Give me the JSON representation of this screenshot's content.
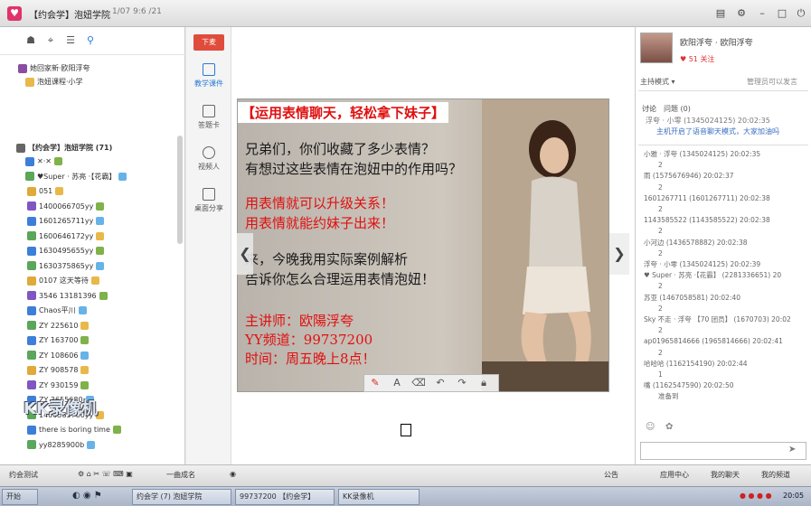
{
  "window": {
    "title": "【约会学】泡妞学院",
    "subtitle": "1/07  9:6  /21"
  },
  "left_panel": {
    "top_items": [
      {
        "label": "她回家新·欧阳浮夸"
      },
      {
        "label": "泡妞课程·小学"
      }
    ],
    "channel": "【约会学】泡妞学院 (71)",
    "members": [
      {
        "name": "✕·✕"
      },
      {
        "name": "♥Super · 苏亮 ·【花霸】"
      },
      {
        "name": "051"
      },
      {
        "name": "1400066705yy"
      },
      {
        "name": "1601265711yy"
      },
      {
        "name": "1600646172yy"
      },
      {
        "name": "1630495655yy"
      },
      {
        "name": "1630375865yy"
      },
      {
        "name": "0107 这天等待"
      },
      {
        "name": "3546 13181396"
      },
      {
        "name": "Chaos平川"
      },
      {
        "name": "ZY 225610"
      },
      {
        "name": "ZY 163700"
      },
      {
        "name": "ZY 108606"
      },
      {
        "name": "ZY 908578"
      },
      {
        "name": "ZY 930159"
      },
      {
        "name": "ZY 3655680"
      },
      {
        "name": "1400585700yy"
      },
      {
        "name": "there is boring time"
      },
      {
        "name": "yy8285900b"
      }
    ]
  },
  "toolstrip": {
    "down_label": "下麦",
    "tools": [
      {
        "label": "教学课件"
      },
      {
        "label": "答题卡"
      },
      {
        "label": "视频人"
      },
      {
        "label": "桌面分享"
      }
    ]
  },
  "slide": {
    "banner": "【运用表情聊天，轻松拿下妹子】",
    "lines_black1": [
      "兄弟们，你们收藏了多少表情？",
      "有想过这些表情在泡妞中的作用吗？"
    ],
    "lines_red1": [
      "用表情就可以升级关系！",
      "用表情就能约妹子出来！"
    ],
    "lines_black2": [
      "来，今晚我用实际案例解析",
      "告诉你怎么合理运用表情泡妞！"
    ],
    "lines_red2": [
      "主讲师：欧陽浮夸",
      "YY频道：99737200",
      "时间：周五晚上8点！"
    ]
  },
  "drawbar": {
    "tools": [
      "pen-icon",
      "text-icon",
      "eraser-icon",
      "undo-icon",
      "redo-icon",
      "lock-icon"
    ]
  },
  "right_panel": {
    "host_name": "欧阳浮夸 · 欧阳浮夸",
    "likes": "♥ 51 关注",
    "mode": "主持模式 ▾",
    "manage": "管理员可以发言",
    "tab1": "讨论",
    "tab2": "问题 (0)",
    "pinned": "浮夸 · 小零 (1345024125) 20:02:35",
    "pinned2": "主机开启了语音聊天模式，大家加油吗",
    "messages": [
      "小雅 · 浮夸 (1345024125) 20:02:35",
      "2",
      "雨 (1575676946) 20:02:37",
      "2",
      "1601267711 (1601267711) 20:02:38",
      "2",
      "1143585522 (1143585522) 20:02:38",
      "2",
      "小河边 (1436578882) 20:02:38",
      "2",
      "浮夸 · 小零 (1345024125) 20:02:39",
      "♥ Super · 苏亮 ·【花霸】 (2281336651) 20",
      "2",
      "苏亚 (1467058581) 20:02:40",
      "2",
      "Sky 不走 · 浮夸 【70 团员】 (1670703) 20:02",
      "2",
      "ap01965814666 (1965814666) 20:02:41",
      "2",
      "哈哈哈 (1162154190) 20:02:44",
      "1",
      "嘴 (1162547590) 20:02:50",
      "准备到"
    ]
  },
  "statusbar": {
    "items": [
      "约会测试",
      "一曲成名",
      "公告",
      "应用中心",
      "我的聊天",
      "我的频道"
    ]
  },
  "taskbar": {
    "start": "开始",
    "items": [
      "约会学 (7) 泡妞学院",
      "99737200 【约会学】",
      "KK录像机"
    ],
    "time": "20:05"
  },
  "watermark": "KK录像机"
}
